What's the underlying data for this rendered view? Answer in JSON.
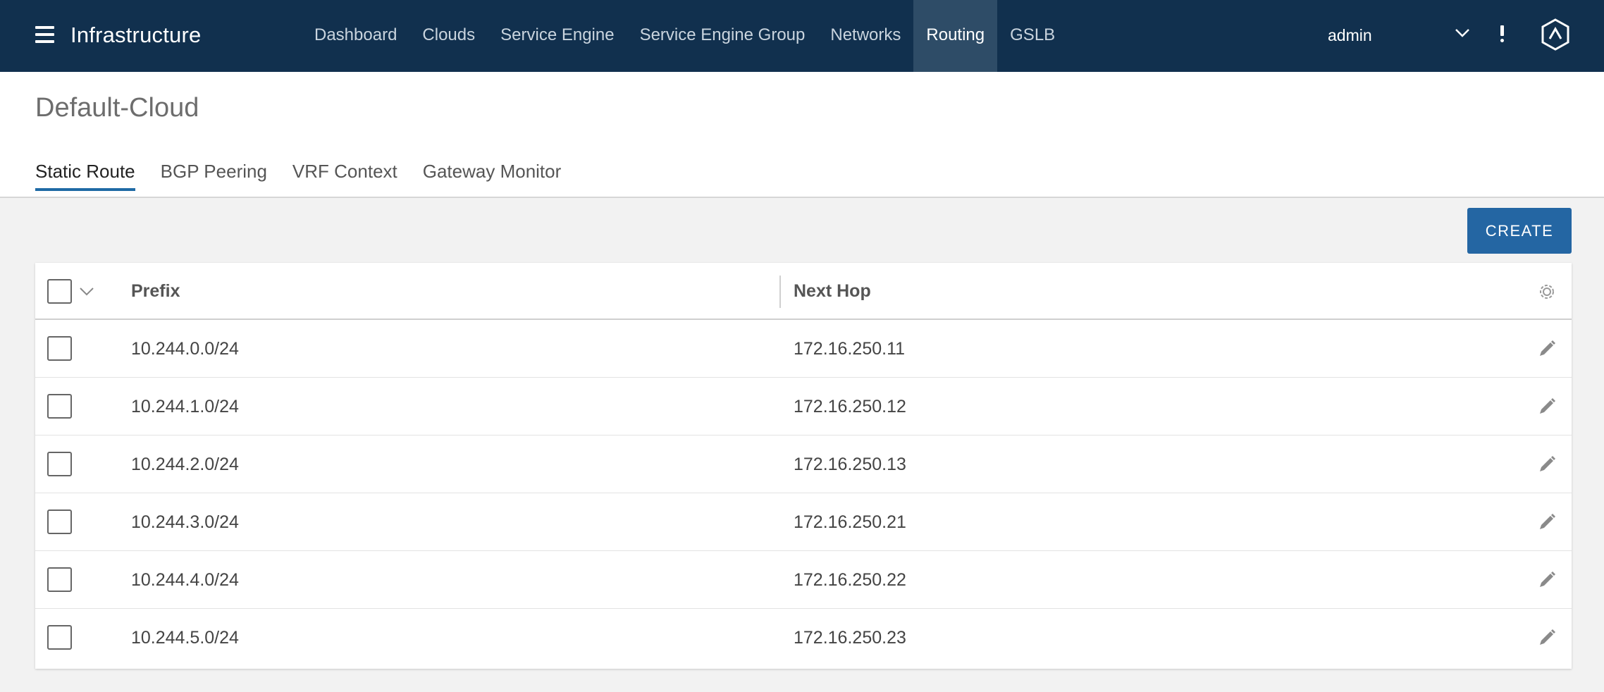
{
  "header": {
    "app_title": "Infrastructure",
    "nav": [
      {
        "label": "Dashboard"
      },
      {
        "label": "Clouds"
      },
      {
        "label": "Service Engine"
      },
      {
        "label": "Service Engine Group"
      },
      {
        "label": "Networks"
      },
      {
        "label": "Routing",
        "active": true
      },
      {
        "label": "GSLB"
      }
    ],
    "user": "admin",
    "icons": [
      "menu-icon",
      "chevron-down-icon",
      "alert-icon",
      "logo-icon"
    ]
  },
  "page": {
    "title": "Default-Cloud",
    "tabs": [
      {
        "label": "Static Route",
        "active": true
      },
      {
        "label": "BGP Peering"
      },
      {
        "label": "VRF Context"
      },
      {
        "label": "Gateway Monitor"
      }
    ],
    "create_label": "CREATE"
  },
  "table": {
    "columns": {
      "prefix": "Prefix",
      "next_hop": "Next Hop"
    },
    "rows": [
      {
        "prefix": "10.244.0.0/24",
        "next_hop": "172.16.250.11"
      },
      {
        "prefix": "10.244.1.0/24",
        "next_hop": "172.16.250.12"
      },
      {
        "prefix": "10.244.2.0/24",
        "next_hop": "172.16.250.13"
      },
      {
        "prefix": "10.244.3.0/24",
        "next_hop": "172.16.250.21"
      },
      {
        "prefix": "10.244.4.0/24",
        "next_hop": "172.16.250.22"
      },
      {
        "prefix": "10.244.5.0/24",
        "next_hop": "172.16.250.23"
      }
    ]
  },
  "colors": {
    "navbar": "#11304e",
    "active_nav": "#2e4c67",
    "accent": "#2466a3",
    "tab_underline": "#1f6aa5"
  }
}
